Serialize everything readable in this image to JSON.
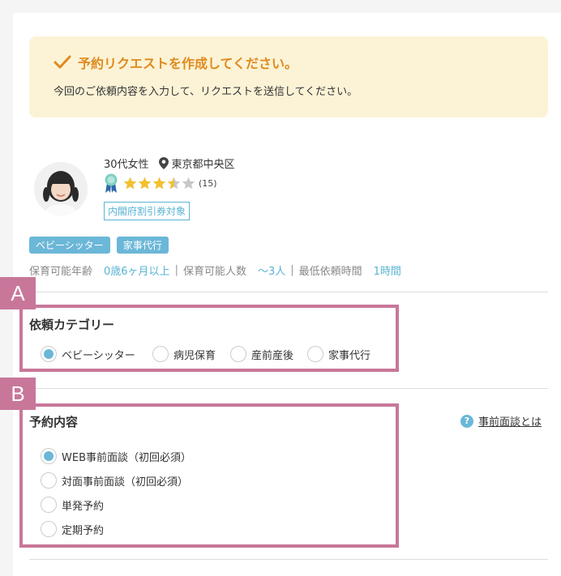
{
  "notice": {
    "title": "予約リクエストを作成してください。",
    "body": "今回のご依頼内容を入力して、リクエストを送信してください。"
  },
  "profile": {
    "age_gender": "30代女性",
    "location": "東京都中央区",
    "rating": 3.5,
    "review_count": "(15)",
    "subsidy_tag": "内閣府割引券対象",
    "service_tags": [
      "ベビーシッター",
      "家事代行"
    ],
    "conditions": {
      "age_label": "保育可能年齢",
      "age_value": "0歳6ヶ月以上",
      "capacity_label": "保育可能人数",
      "capacity_value": "〜3人",
      "min_time_label": "最低依頼時間",
      "min_time_value": "1時間"
    }
  },
  "section_a": {
    "badge": "A",
    "title": "依頼カテゴリー",
    "options": [
      "ベビーシッター",
      "病児保育",
      "産前産後",
      "家事代行"
    ],
    "selected": 0
  },
  "section_b": {
    "badge": "B",
    "title": "予約内容",
    "help_link": "事前面談とは",
    "options": [
      "WEB事前面談（初回必須）",
      "対面事前面談（初回必須）",
      "単発予約",
      "定期予約"
    ],
    "selected": 0
  },
  "colors": {
    "accent": "#6bb7d8",
    "highlight": "#c8779a",
    "notice_bg": "#fcf3d6",
    "notice_title": "#e08a1e",
    "star": "#f2c12e"
  }
}
